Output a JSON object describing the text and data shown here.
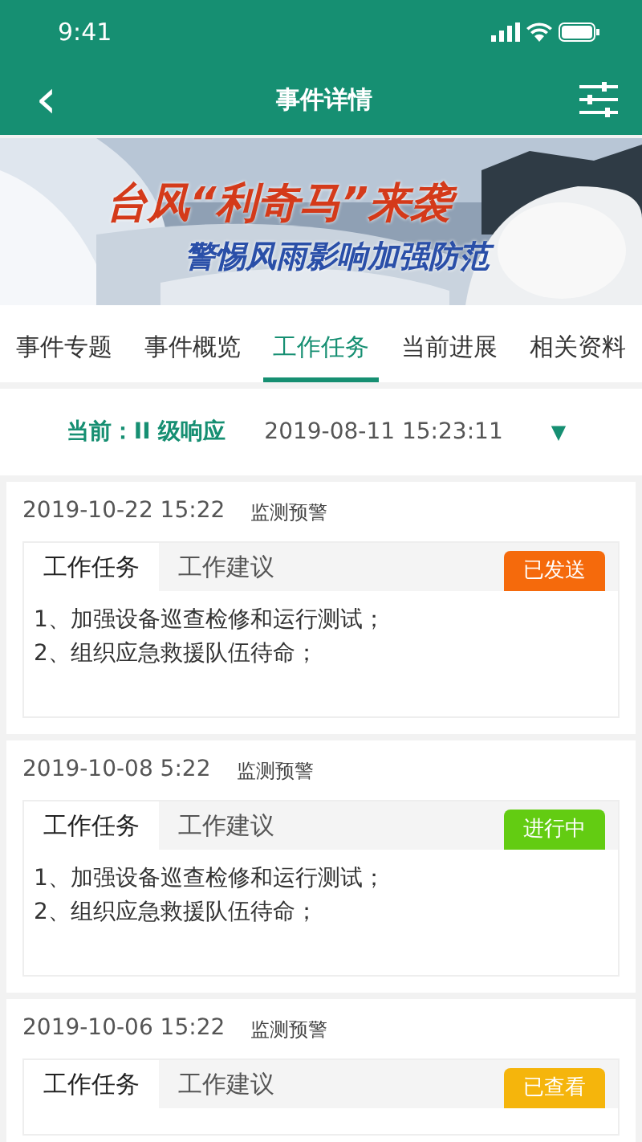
{
  "status_bar": {
    "time": "9:41"
  },
  "header": {
    "back": "‹",
    "title": "事件详情"
  },
  "banner": {
    "kind": "picture",
    "headline": "台风“利奇马”来袭",
    "subtitle": "警惕风雨影响加强防范"
  },
  "tabs": [
    {
      "label": "事件专题",
      "selected": false
    },
    {
      "label": "事件概览",
      "selected": false
    },
    {
      "label": "工作任务",
      "selected": true
    },
    {
      "label": "当前进展",
      "selected": false
    },
    {
      "label": "相关资料",
      "selected": false
    }
  ],
  "current": {
    "label": "当前：II 级响应",
    "time": "2019-08-11 15:23:11",
    "caret": "▼"
  },
  "records": [
    {
      "time": "2019-10-22 15:22",
      "category": "监测预警",
      "tabs": [
        {
          "label": "工作任务",
          "selected": true
        },
        {
          "label": "工作建议",
          "selected": false
        }
      ],
      "status": "已发送",
      "color": "#f56a0c",
      "lines": [
        "1、加强设备巡查检修和运行测试；",
        "2、组织应急救援队伍待命；"
      ]
    },
    {
      "time": "2019-10-08 5:22",
      "category": "监测预警",
      "tabs": [
        {
          "label": "工作任务",
          "selected": true
        },
        {
          "label": "工作建议",
          "selected": false
        }
      ],
      "status": "进行中",
      "color": "#63cc12",
      "lines": [
        "1、加强设备巡查检修和运行测试；",
        "2、组织应急救援队伍待命；"
      ]
    },
    {
      "time": "2019-10-06 15:22",
      "category": "监测预警",
      "tabs": [
        {
          "label": "工作任务",
          "selected": true
        },
        {
          "label": "工作建议",
          "selected": false
        }
      ],
      "status": "已查看",
      "color": "#f5b50c"
    }
  ]
}
